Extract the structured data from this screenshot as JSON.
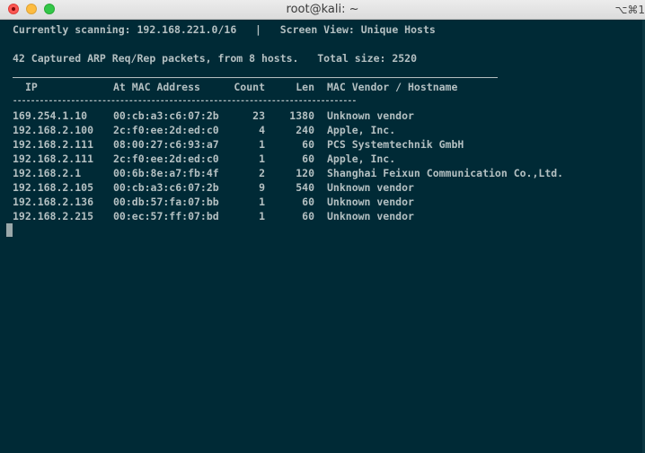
{
  "window": {
    "title": "root@kali: ~",
    "shortcut": "⌥⌘1"
  },
  "status": {
    "scanning_line": "Currently scanning: 192.168.221.0/16   |   Screen View: Unique Hosts",
    "summary_line": "42 Captured ARP Req/Rep packets, from 8 hosts.   Total size: 2520"
  },
  "table": {
    "columns": {
      "ip": "IP",
      "mac": "At MAC Address",
      "count": "Count",
      "len": "Len",
      "vendor": "MAC Vendor / Hostname"
    },
    "separator": "-----------------------------------------------------------------------------",
    "rows": [
      {
        "ip": "169.254.1.10",
        "mac": "00:cb:a3:c6:07:2b",
        "count": "23",
        "len": "1380",
        "vendor": "Unknown vendor"
      },
      {
        "ip": "192.168.2.100",
        "mac": "2c:f0:ee:2d:ed:c0",
        "count": "4",
        "len": "240",
        "vendor": "Apple, Inc."
      },
      {
        "ip": "192.168.2.111",
        "mac": "08:00:27:c6:93:a7",
        "count": "1",
        "len": "60",
        "vendor": "PCS Systemtechnik GmbH"
      },
      {
        "ip": "192.168.2.111",
        "mac": "2c:f0:ee:2d:ed:c0",
        "count": "1",
        "len": "60",
        "vendor": "Apple, Inc."
      },
      {
        "ip": "192.168.2.1",
        "mac": "00:6b:8e:a7:fb:4f",
        "count": "2",
        "len": "120",
        "vendor": "Shanghai Feixun Communication Co.,Ltd."
      },
      {
        "ip": "192.168.2.105",
        "mac": "00:cb:a3:c6:07:2b",
        "count": "9",
        "len": "540",
        "vendor": "Unknown vendor"
      },
      {
        "ip": "192.168.2.136",
        "mac": "00:db:57:fa:07:bb",
        "count": "1",
        "len": "60",
        "vendor": "Unknown vendor"
      },
      {
        "ip": "192.168.2.215",
        "mac": "00:ec:57:ff:07:bd",
        "count": "1",
        "len": "60",
        "vendor": "Unknown vendor"
      }
    ]
  },
  "colors": {
    "terminal_background": "#002a36",
    "terminal_text": "#b4c0c2"
  }
}
